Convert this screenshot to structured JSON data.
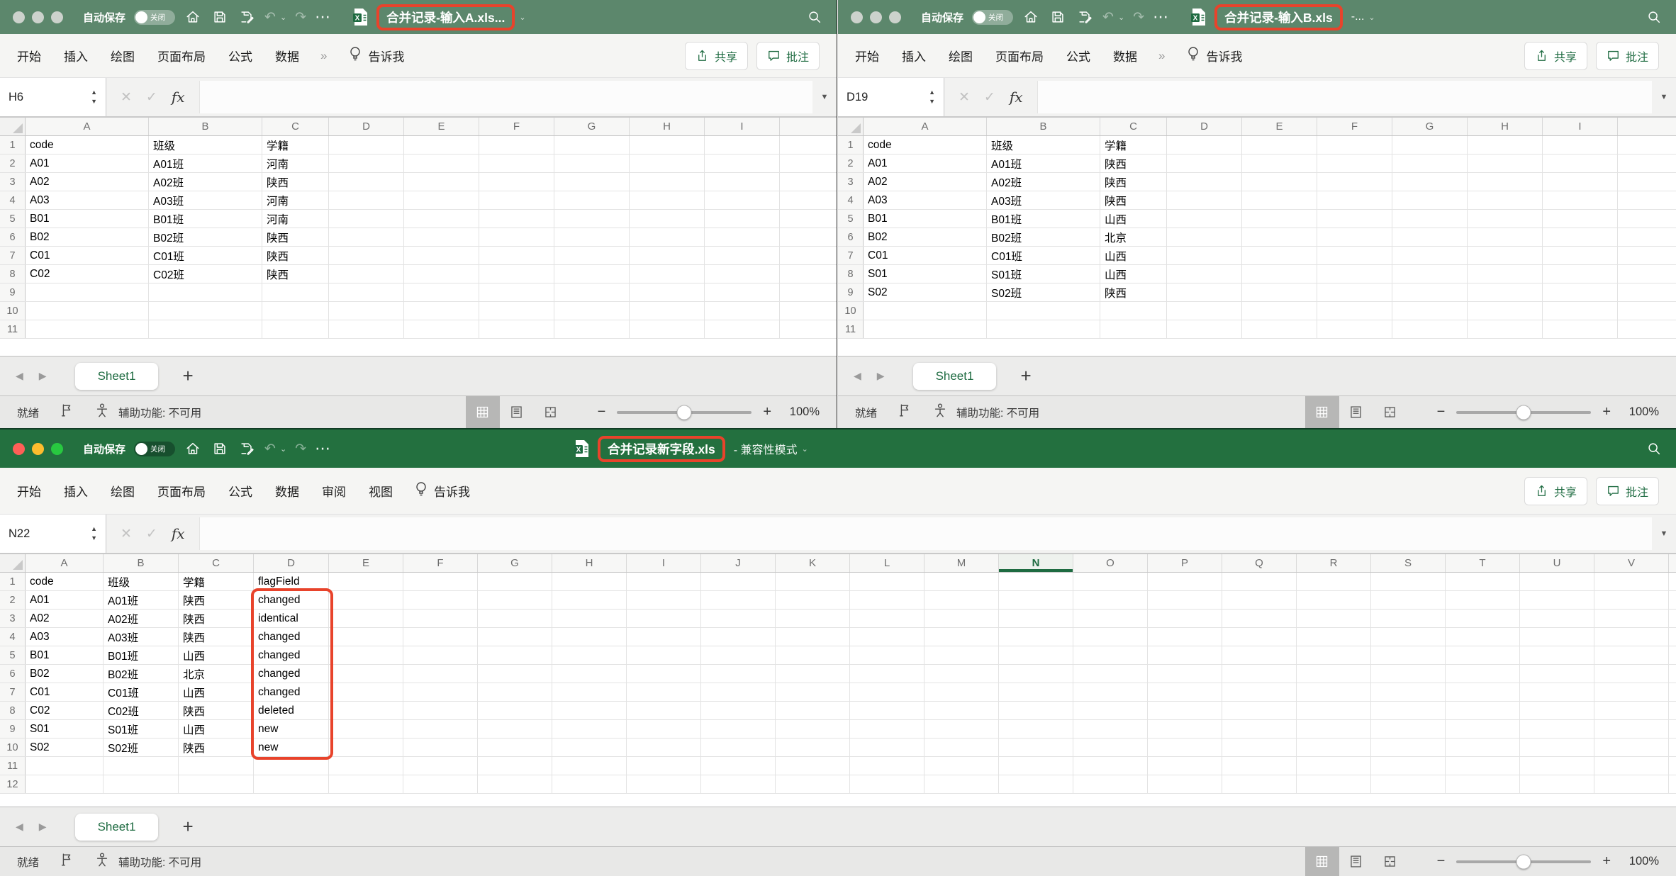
{
  "accent": {
    "annotation_red": "#e8432b",
    "excel_green_active": "#23703f",
    "excel_green_inactive": "#5c876c",
    "selection_green": "#1e6b41"
  },
  "common": {
    "autosave": "自动保存",
    "autosave_state": "关闭",
    "tellme": "告诉我",
    "overflow": "»",
    "share": "共享",
    "comment": "批注",
    "formula_cancel": "✕",
    "formula_check": "✓",
    "formula_fx": "fx",
    "formula_dropdown": "▼",
    "title_caret": "⌄",
    "undo_glyph": "↶",
    "redo_glyph": "↷",
    "ellipsis": "⋯",
    "nav_prev": "◀",
    "nav_next": "▶",
    "sheet_tab": "Sheet1",
    "add_sheet": "+",
    "ready": "就绪",
    "accessibility": "辅助功能: 不可用",
    "zoom_minus": "−",
    "zoom_plus": "+",
    "zoom_level": "100%"
  },
  "windows": {
    "a": {
      "title": "合并记录-输入A.xls...",
      "suffix": "",
      "name_box": "H6",
      "tabs": [
        "开始",
        "插入",
        "绘图",
        "页面布局",
        "公式",
        "数据"
      ],
      "grid": {
        "columns": [
          "A",
          "B",
          "C",
          "D",
          "E",
          "F",
          "G",
          "H",
          "I"
        ],
        "rows": 11,
        "cells": [
          [
            "code",
            "班级",
            "学籍"
          ],
          [
            "A01",
            "A01班",
            "河南"
          ],
          [
            "A02",
            "A02班",
            "陕西"
          ],
          [
            "A03",
            "A03班",
            "河南"
          ],
          [
            "B01",
            "B01班",
            "河南"
          ],
          [
            "B02",
            "B02班",
            "陕西"
          ],
          [
            "C01",
            "C01班",
            "陕西"
          ],
          [
            "C02",
            "C02班",
            "陕西"
          ]
        ]
      }
    },
    "b": {
      "title": "合并记录-输入B.xls",
      "suffix": "-...",
      "name_box": "D19",
      "tabs": [
        "开始",
        "插入",
        "绘图",
        "页面布局",
        "公式",
        "数据"
      ],
      "grid": {
        "columns": [
          "A",
          "B",
          "C",
          "D",
          "E",
          "F",
          "G",
          "H",
          "I"
        ],
        "rows": 11,
        "cells": [
          [
            "code",
            "班级",
            "学籍"
          ],
          [
            "A01",
            "A01班",
            "陕西"
          ],
          [
            "A02",
            "A02班",
            "陕西"
          ],
          [
            "A03",
            "A03班",
            "陕西"
          ],
          [
            "B01",
            "B01班",
            "山西"
          ],
          [
            "B02",
            "B02班",
            "北京"
          ],
          [
            "C01",
            "C01班",
            "山西"
          ],
          [
            "S01",
            "S01班",
            "山西"
          ],
          [
            "S02",
            "S02班",
            "陕西"
          ]
        ]
      }
    },
    "c": {
      "title": "合并记录新字段.xls",
      "suffix": "- 兼容性模式",
      "name_box": "N22",
      "tabs": [
        "开始",
        "插入",
        "绘图",
        "页面布局",
        "公式",
        "数据",
        "审阅",
        "视图"
      ],
      "grid": {
        "columns": [
          "A",
          "B",
          "C",
          "D",
          "E",
          "F",
          "G",
          "H",
          "I",
          "J",
          "K",
          "L",
          "M",
          "N",
          "O",
          "P",
          "Q",
          "R",
          "S",
          "T",
          "U",
          "V"
        ],
        "selected_col": "N",
        "rows": 12,
        "cells": [
          [
            "code",
            "班级",
            "学籍",
            "flagField"
          ],
          [
            "A01",
            "A01班",
            "陕西",
            "changed"
          ],
          [
            "A02",
            "A02班",
            "陕西",
            "identical"
          ],
          [
            "A03",
            "A03班",
            "陕西",
            "changed"
          ],
          [
            "B01",
            "B01班",
            "山西",
            "changed"
          ],
          [
            "B02",
            "B02班",
            "北京",
            "changed"
          ],
          [
            "C01",
            "C01班",
            "山西",
            "changed"
          ],
          [
            "C02",
            "C02班",
            "陕西",
            "deleted"
          ],
          [
            "S01",
            "S01班",
            "山西",
            "new"
          ],
          [
            "S02",
            "S02班",
            "陕西",
            "new"
          ]
        ]
      }
    }
  }
}
